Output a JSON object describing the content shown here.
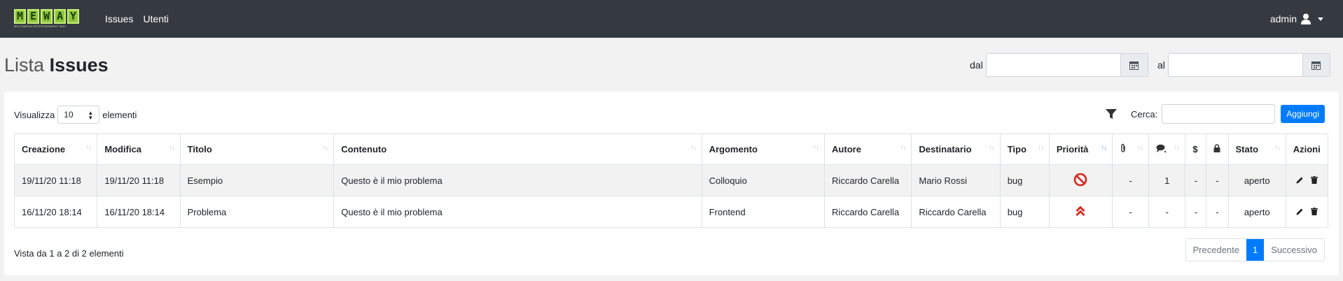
{
  "navbar": {
    "logo_text": "MEWAY",
    "logo_tagline": "MULTIMEDIA ENTERTAINMENT WAY",
    "links": [
      "Issues",
      "Utenti"
    ],
    "user": "admin"
  },
  "header": {
    "title_prefix": "Lista",
    "title_main": "Issues",
    "from_label": "dal",
    "to_label": "al"
  },
  "controls": {
    "show_label": "Visualizza",
    "page_size": "10",
    "elements_label": "elementi",
    "search_label": "Cerca:",
    "add_button": "Aggiungi"
  },
  "table": {
    "columns": [
      "Creazione",
      "Modifica",
      "Titolo",
      "Contenuto",
      "Argomento",
      "Autore",
      "Destinatario",
      "Tipo",
      "Priorità",
      "",
      "",
      "",
      "",
      "Stato",
      "Azioni"
    ],
    "rows": [
      {
        "creazione": "19/11/20 11:18",
        "modifica": "19/11/20 11:18",
        "titolo": "Esempio",
        "contenuto": "Questo è il mio problema",
        "argomento": "Colloquio",
        "autore": "Riccardo Carella",
        "destinatario": "Mario Rossi",
        "tipo": "bug",
        "priorita_icon": "ban-icon",
        "allegati": "-",
        "commenti": "1",
        "costo": "-",
        "privato": "-",
        "stato": "aperto"
      },
      {
        "creazione": "16/11/20 18:14",
        "modifica": "16/11/20 18:14",
        "titolo": "Problema",
        "contenuto": "Questo è il mio problema",
        "argomento": "Frontend",
        "autore": "Riccardo Carella",
        "destinatario": "Riccardo Carella",
        "tipo": "bug",
        "priorita_icon": "double-chevron-up-icon",
        "allegati": "-",
        "commenti": "-",
        "costo": "-",
        "privato": "-",
        "stato": "aperto"
      }
    ]
  },
  "footer": {
    "info": "Vista da 1 a 2 di 2 elementi",
    "prev": "Precedente",
    "page": "1",
    "next": "Successivo"
  },
  "colors": {
    "navbar": "#343a40",
    "accent": "#007bff",
    "logo_green": "#8ec63f",
    "priority_red": "#d9261c"
  }
}
